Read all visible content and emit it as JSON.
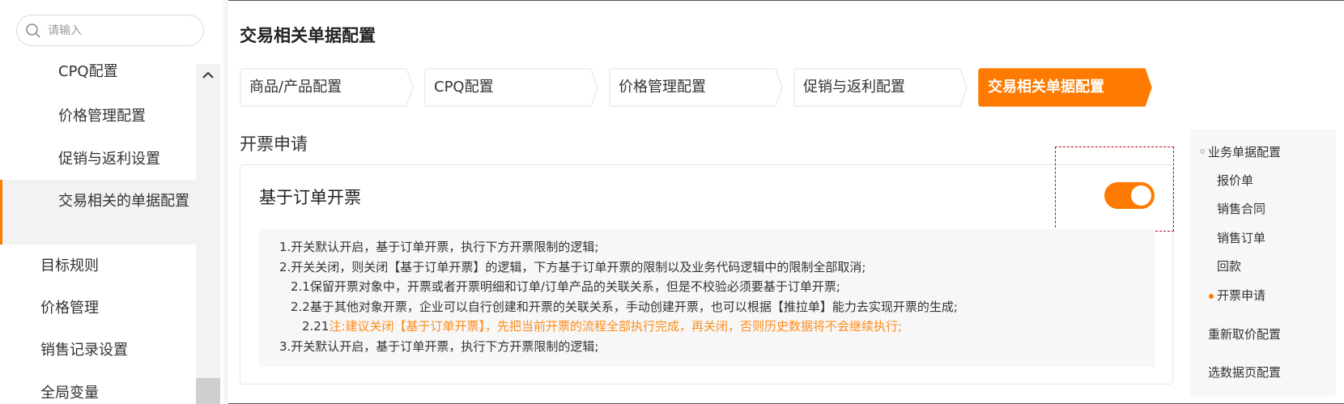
{
  "search": {
    "placeholder": "请输入"
  },
  "sidebar": {
    "items": [
      {
        "label": "CPQ配置"
      },
      {
        "label": "价格管理配置"
      },
      {
        "label": "促销与返利设置"
      },
      {
        "label": "交易相关的单据配置"
      },
      {
        "label": "目标规则"
      },
      {
        "label": "价格管理"
      },
      {
        "label": "销售记录设置"
      },
      {
        "label": "全局变量"
      }
    ]
  },
  "page": {
    "title": "交易相关单据配置"
  },
  "steps": [
    {
      "label": "商品/产品配置"
    },
    {
      "label": "CPQ配置"
    },
    {
      "label": "价格管理配置"
    },
    {
      "label": "促销与返利配置"
    },
    {
      "label": "交易相关单据配置",
      "active": true
    }
  ],
  "section": {
    "title": "开票申请"
  },
  "card": {
    "title": "基于订单开票",
    "toggle": {
      "on": true
    },
    "lines": [
      "1.开关默认开启，基于订单开票，执行下方开票限制的逻辑;",
      "2.开关关闭，则关闭【基于订单开票】的逻辑，下方基于订单开票的限制以及业务代码逻辑中的限制全部取消;",
      "2.1保留开票对象中，开票或者开票明细和订单/订单产品的关联关系，但是不校验必须要基于订单开票;",
      "2.2基于其他对象开票，企业可以自行创建和开票的关联关系，手动创建开票，也可以根据【推拉单】能力去实现开票的生成;",
      "3.开关默认开启，基于订单开票，执行下方开票限制的逻辑;"
    ],
    "note": {
      "prefix": "2.21",
      "text": "注:建议关闭【基于订单开票】，先把当前开票的流程全部执行完成，再关闭，否则历史数据将不会继续执行;"
    }
  },
  "anchor_nav": {
    "group": "业务单据配置",
    "items": [
      {
        "label": "报价单"
      },
      {
        "label": "销售合同"
      },
      {
        "label": "销售订单"
      },
      {
        "label": "回款"
      },
      {
        "label": "开票申请",
        "active": true
      }
    ],
    "extra": [
      {
        "label": "重新取价配置"
      },
      {
        "label": "选数据页配置"
      }
    ]
  },
  "colors": {
    "accent": "#ff7a00",
    "warning_text": "#ff8c1a",
    "highlight_border": "#d0021b"
  }
}
